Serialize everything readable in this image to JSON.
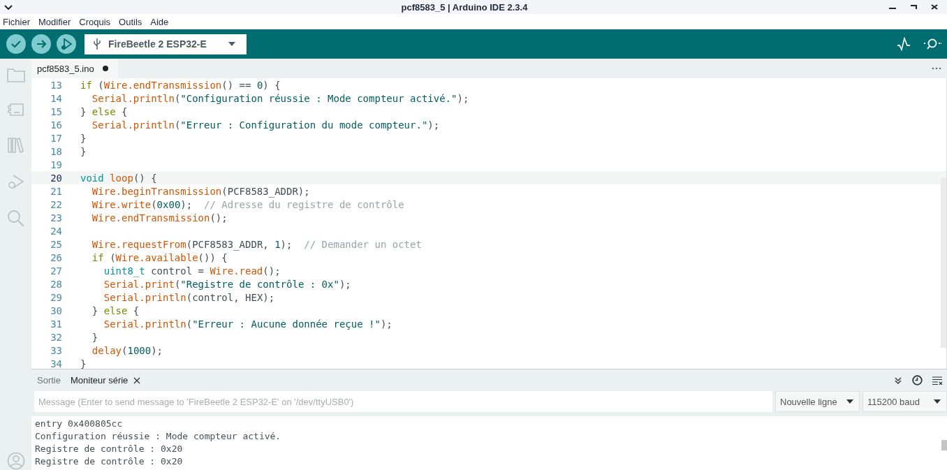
{
  "window": {
    "title": "pcf8583_5 | Arduino IDE 2.3.4"
  },
  "menu": [
    "Fichier",
    "Modifier",
    "Croquis",
    "Outils",
    "Aide"
  ],
  "toolbar": {
    "board": "FireBeetle 2 ESP32-E"
  },
  "editor": {
    "tab": {
      "label": "pcf8583_5.ino",
      "modified": true
    },
    "lines": [
      {
        "number": "13",
        "current": false,
        "tokens": [
          {
            "text": "if",
            "kind": "keyword"
          },
          {
            "text": " (",
            "kind": "plain"
          },
          {
            "text": "Wire",
            "kind": "func"
          },
          {
            "text": ".endTransmission",
            "kind": "func"
          },
          {
            "text": "() == ",
            "kind": "plain"
          },
          {
            "text": "0",
            "kind": "number"
          },
          {
            "text": ") {",
            "kind": "plain"
          }
        ]
      },
      {
        "number": "14",
        "current": false,
        "tokens": [
          {
            "text": "  Serial",
            "kind": "func"
          },
          {
            "text": ".println",
            "kind": "func"
          },
          {
            "text": "(",
            "kind": "plain"
          },
          {
            "text": "\"Configuration réussie : Mode compteur activé.\"",
            "kind": "string"
          },
          {
            "text": ");",
            "kind": "plain"
          }
        ]
      },
      {
        "number": "15",
        "current": false,
        "tokens": [
          {
            "text": "} ",
            "kind": "plain"
          },
          {
            "text": "else",
            "kind": "keyword"
          },
          {
            "text": " {",
            "kind": "plain"
          }
        ]
      },
      {
        "number": "16",
        "current": false,
        "tokens": [
          {
            "text": "  Serial",
            "kind": "func"
          },
          {
            "text": ".println",
            "kind": "func"
          },
          {
            "text": "(",
            "kind": "plain"
          },
          {
            "text": "\"Erreur : Configuration du mode compteur.\"",
            "kind": "string"
          },
          {
            "text": ");",
            "kind": "plain"
          }
        ]
      },
      {
        "number": "17",
        "current": false,
        "tokens": [
          {
            "text": "}",
            "kind": "plain"
          }
        ]
      },
      {
        "number": "18",
        "current": false,
        "tokens": [
          {
            "text": "}",
            "kind": "plain"
          }
        ]
      },
      {
        "number": "19",
        "current": false
      },
      {
        "number": "20",
        "current": true,
        "tokens": [
          {
            "text": "void ",
            "kind": "type"
          },
          {
            "text": "loop",
            "kind": "func"
          },
          {
            "text": "() {",
            "kind": "plain"
          }
        ]
      },
      {
        "number": "21",
        "current": false,
        "tokens": [
          {
            "text": "  Wire",
            "kind": "func"
          },
          {
            "text": ".beginTransmission",
            "kind": "func"
          },
          {
            "text": "(PCF8583_ADDR);",
            "kind": "plain"
          }
        ]
      },
      {
        "number": "22",
        "current": false,
        "tokens": [
          {
            "text": "  Wire",
            "kind": "func"
          },
          {
            "text": ".write",
            "kind": "func"
          },
          {
            "text": "(",
            "kind": "plain"
          },
          {
            "text": "0x00",
            "kind": "number"
          },
          {
            "text": ");  ",
            "kind": "plain"
          },
          {
            "text": "// Adresse du registre de contrôle",
            "kind": "comment"
          }
        ]
      },
      {
        "number": "23",
        "current": false,
        "tokens": [
          {
            "text": "  Wire",
            "kind": "func"
          },
          {
            "text": ".endTransmission",
            "kind": "func"
          },
          {
            "text": "();",
            "kind": "plain"
          }
        ]
      },
      {
        "number": "24",
        "current": false
      },
      {
        "number": "25",
        "current": false,
        "tokens": [
          {
            "text": "  Wire",
            "kind": "func"
          },
          {
            "text": ".requestFrom",
            "kind": "func"
          },
          {
            "text": "(PCF8583_ADDR, ",
            "kind": "plain"
          },
          {
            "text": "1",
            "kind": "number"
          },
          {
            "text": ");  ",
            "kind": "plain"
          },
          {
            "text": "// Demander un octet",
            "kind": "comment"
          }
        ]
      },
      {
        "number": "26",
        "current": false,
        "tokens": [
          {
            "text": "  if",
            "kind": "keyword"
          },
          {
            "text": " (",
            "kind": "plain"
          },
          {
            "text": "Wire",
            "kind": "func"
          },
          {
            "text": ".available",
            "kind": "func"
          },
          {
            "text": "()) {",
            "kind": "plain"
          }
        ]
      },
      {
        "number": "27",
        "current": false,
        "tokens": [
          {
            "text": "    uint8_t",
            "kind": "type"
          },
          {
            "text": " control = ",
            "kind": "plain"
          },
          {
            "text": "Wire",
            "kind": "func"
          },
          {
            "text": ".read",
            "kind": "func"
          },
          {
            "text": "();",
            "kind": "plain"
          }
        ]
      },
      {
        "number": "28",
        "current": false,
        "tokens": [
          {
            "text": "    Serial",
            "kind": "func"
          },
          {
            "text": ".print",
            "kind": "func"
          },
          {
            "text": "(",
            "kind": "plain"
          },
          {
            "text": "\"Registre de contrôle : 0x\"",
            "kind": "string"
          },
          {
            "text": ");",
            "kind": "plain"
          }
        ]
      },
      {
        "number": "29",
        "current": false,
        "tokens": [
          {
            "text": "    Serial",
            "kind": "func"
          },
          {
            "text": ".println",
            "kind": "func"
          },
          {
            "text": "(control, HEX);",
            "kind": "plain"
          }
        ]
      },
      {
        "number": "30",
        "current": false,
        "tokens": [
          {
            "text": "  } ",
            "kind": "plain"
          },
          {
            "text": "else",
            "kind": "keyword"
          },
          {
            "text": " {",
            "kind": "plain"
          }
        ]
      },
      {
        "number": "31",
        "current": false,
        "tokens": [
          {
            "text": "    Serial",
            "kind": "func"
          },
          {
            "text": ".println",
            "kind": "func"
          },
          {
            "text": "(",
            "kind": "plain"
          },
          {
            "text": "\"Erreur : Aucune donnée reçue !\"",
            "kind": "string"
          },
          {
            "text": ");",
            "kind": "plain"
          }
        ]
      },
      {
        "number": "32",
        "current": false,
        "tokens": [
          {
            "text": "  }",
            "kind": "plain"
          }
        ]
      },
      {
        "number": "33",
        "current": false,
        "tokens": [
          {
            "text": "  delay",
            "kind": "func"
          },
          {
            "text": "(",
            "kind": "plain"
          },
          {
            "text": "1000",
            "kind": "number"
          },
          {
            "text": ");",
            "kind": "plain"
          }
        ]
      },
      {
        "number": "34",
        "current": false,
        "tokens": [
          {
            "text": "}",
            "kind": "plain"
          }
        ]
      }
    ]
  },
  "panel": {
    "tabs": [
      {
        "label": "Sortie",
        "selected": false
      },
      {
        "label": "Moniteur série",
        "selected": true
      }
    ],
    "message": {
      "placeholder": "Message (Enter to send message to 'FireBeetle 2 ESP32-E' on '/dev/ttyUSB0')"
    },
    "line_ending": "Nouvelle ligne",
    "baud": "115200 baud",
    "output": [
      "entry 0x400805cc",
      "Configuration réussie : Mode compteur activé.",
      "Registre de contrôle : 0x20",
      "Registre de contrôle : 0x20"
    ]
  }
}
